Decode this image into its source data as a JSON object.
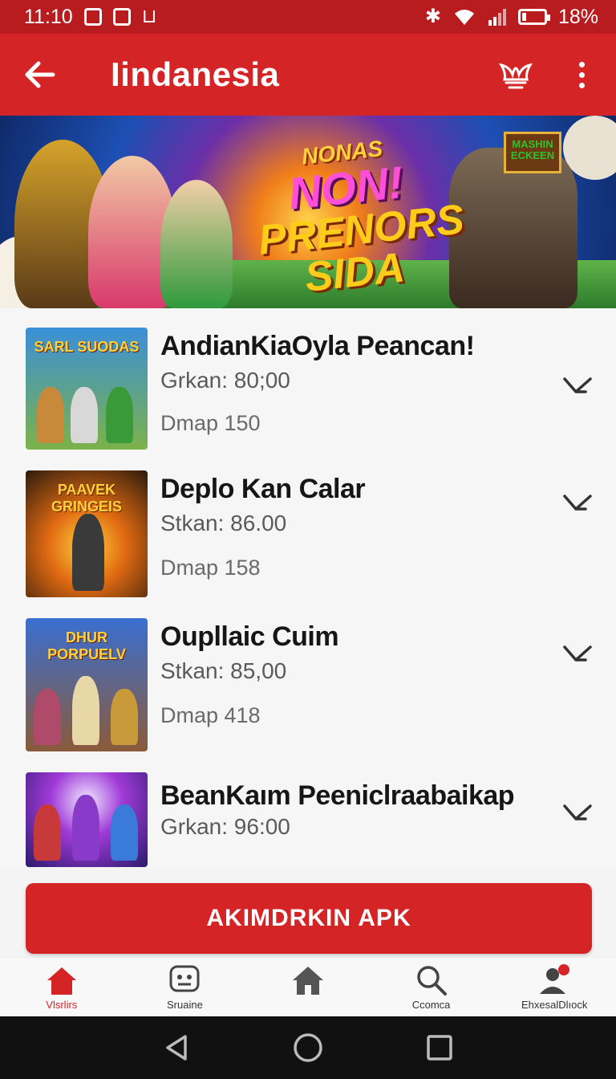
{
  "status_bar": {
    "time": "11:10",
    "battery": "18%",
    "battery_level": 0.18
  },
  "app_bar": {
    "title": "Iindanesia",
    "back_icon": "arrow-left-icon",
    "action_icon": "jester-hat-icon",
    "more_icon": "more-vertical-icon"
  },
  "banner": {
    "line1": "NONAS",
    "line2": "NON!",
    "line3": "PRENORS",
    "line4": "SIDA",
    "sign": "MASHIN ECKEEN"
  },
  "items": [
    {
      "title": "AndianKiaOyla Peancan!",
      "price": "Grkan: 80;00",
      "meta": "Dmap 150",
      "thumb_title": "SARL SUODAS"
    },
    {
      "title": "Deplo Kan Calar",
      "price": "Stkan: 86.00",
      "meta": "Dmap 158",
      "thumb_title": "PAAVEK GRINGEIS"
    },
    {
      "title": "Oupllaic Cuim",
      "price": "Stkan: 85,00",
      "meta": "Dmap 418",
      "thumb_title": "DHUR PORPUELV"
    },
    {
      "title": "BeanKaım Peeniclraabaikap",
      "price": "Grkan: 96:00",
      "meta": "",
      "thumb_title": ""
    }
  ],
  "cta": {
    "label": "AKIMDRKIN APK"
  },
  "bottom_nav": [
    {
      "label": "Vlsrlirs",
      "icon": "home-icon",
      "active": true
    },
    {
      "label": "Sruaine",
      "icon": "gamepad-icon",
      "active": false
    },
    {
      "label": "",
      "icon": "home-outline-icon",
      "active": false
    },
    {
      "label": "Ccomca",
      "icon": "search-icon",
      "active": false
    },
    {
      "label": "EhxesalDlıock",
      "icon": "profile-icon",
      "active": false
    }
  ],
  "colors": {
    "primary": "#d42426",
    "status_bar": "#b81c1e"
  }
}
